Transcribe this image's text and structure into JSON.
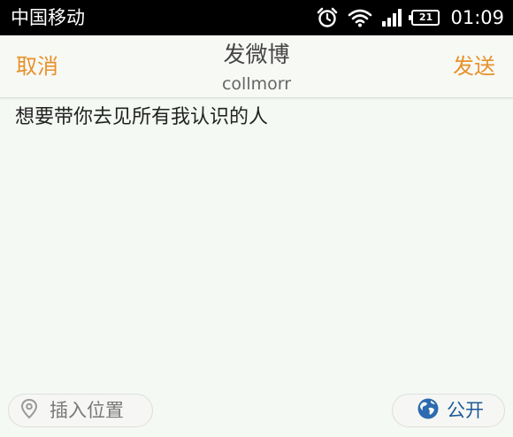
{
  "status_bar": {
    "carrier": "中国移动",
    "battery_level": "21",
    "time": "01:09",
    "icons": [
      "alarm-icon",
      "wifi-icon",
      "signal-icon",
      "battery-icon"
    ]
  },
  "nav": {
    "cancel_label": "取消",
    "title": "发微博",
    "subtitle": "collmorr",
    "send_label": "发送"
  },
  "compose": {
    "text": "想要带你去见所有我认识的人"
  },
  "footer": {
    "location_label": "插入位置",
    "visibility_label": "公开"
  },
  "colors": {
    "accent": "#e8912a",
    "background": "#f4f9f3",
    "visibility_text": "#1f5a9a"
  }
}
